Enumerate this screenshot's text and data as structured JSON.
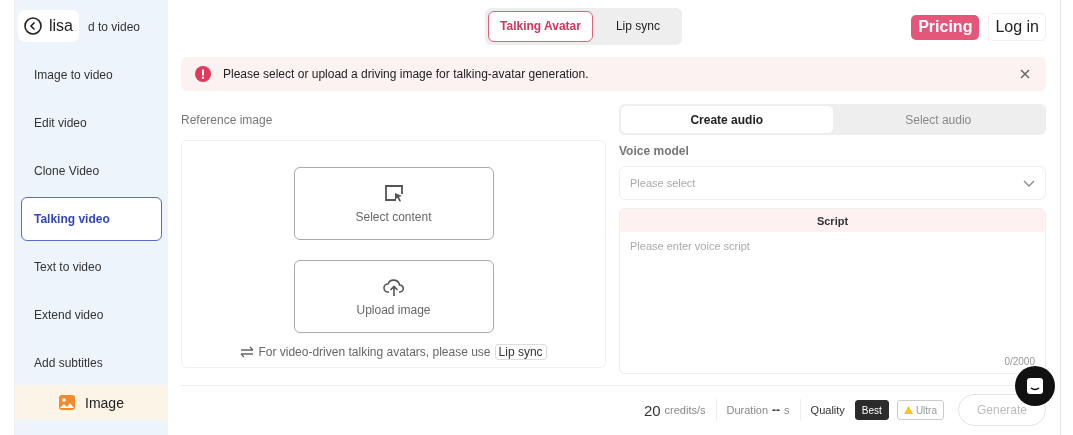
{
  "back_button": {
    "label": "lisa"
  },
  "sidebar": {
    "items": [
      {
        "label": "d to video",
        "selected": false
      },
      {
        "label": "Image to video",
        "selected": false
      },
      {
        "label": "Edit video",
        "selected": false
      },
      {
        "label": "Clone Video",
        "selected": false
      },
      {
        "label": "Talking video",
        "selected": true
      },
      {
        "label": "Text to video",
        "selected": false
      },
      {
        "label": "Extend video",
        "selected": false
      },
      {
        "label": "Add subtitles",
        "selected": false
      }
    ],
    "footer": {
      "label": "Image"
    }
  },
  "mode_tabs": [
    {
      "label": "Talking Avatar",
      "selected": true
    },
    {
      "label": "Lip sync",
      "selected": false
    }
  ],
  "pricing_button": "Pricing",
  "login_button": "Log in",
  "alert": {
    "message": "Please select or upload a driving image for talking-avatar generation."
  },
  "reference": {
    "title": "Reference image",
    "select_label": "Select content",
    "upload_label": "Upload image",
    "hint": "For video-driven talking avatars, please use",
    "hint_link": "Lip sync"
  },
  "audio_tabs": [
    {
      "label": "Create audio",
      "selected": true
    },
    {
      "label": "Select audio",
      "selected": false
    }
  ],
  "voice_model": {
    "label": "Voice model",
    "placeholder": "Please select"
  },
  "script": {
    "title": "Script",
    "placeholder": "Please enter voice script",
    "counter": "0/2000"
  },
  "footer_bar": {
    "credits": "20",
    "credits_unit": "credits/s",
    "duration_label": "Duration",
    "duration_value": "--",
    "duration_unit": "s",
    "quality_label": "Quality",
    "quality_options": [
      {
        "label": "Best",
        "selected": true
      },
      {
        "label": "Ultra",
        "selected": false
      }
    ],
    "generate": "Generate"
  }
}
